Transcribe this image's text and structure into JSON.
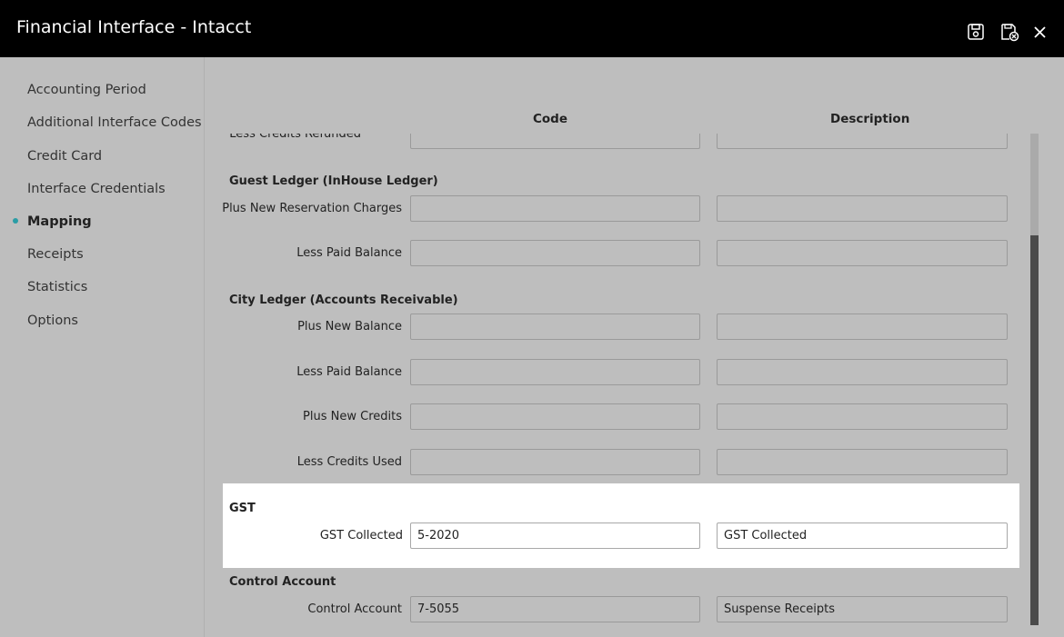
{
  "window": {
    "title": "Financial Interface - Intacct"
  },
  "toolbar": {
    "icons": [
      "save-icon",
      "save-close-icon",
      "close-icon"
    ]
  },
  "sidebar": {
    "items": [
      {
        "label": "Accounting Period"
      },
      {
        "label": "Additional Interface Codes"
      },
      {
        "label": "Credit Card"
      },
      {
        "label": "Interface Credentials"
      },
      {
        "label": "Mapping",
        "active": true
      },
      {
        "label": "Receipts"
      },
      {
        "label": "Statistics"
      },
      {
        "label": "Options"
      }
    ]
  },
  "columns": {
    "code": "Code",
    "description": "Description"
  },
  "partial_row": {
    "label": "Less Credits Refunded"
  },
  "sections": {
    "guest": {
      "title": "Guest Ledger (InHouse Ledger)",
      "rows": [
        {
          "label": "Plus New Reservation Charges",
          "code": "",
          "description": ""
        },
        {
          "label": "Less Paid Balance",
          "code": "",
          "description": ""
        }
      ]
    },
    "city": {
      "title": "City Ledger (Accounts Receivable)",
      "rows": [
        {
          "label": "Plus New Balance",
          "code": "",
          "description": ""
        },
        {
          "label": "Less Paid Balance",
          "code": "",
          "description": ""
        },
        {
          "label": "Plus New Credits",
          "code": "",
          "description": ""
        },
        {
          "label": "Less Credits Used",
          "code": "",
          "description": ""
        }
      ]
    },
    "gst": {
      "title": "GST",
      "rows": [
        {
          "label": "GST Collected",
          "code": "5-2020",
          "description": "GST Collected"
        }
      ]
    },
    "control": {
      "title": "Control Account",
      "rows": [
        {
          "label": "Control Account",
          "code": "7-5055",
          "description": "Suspense Receipts"
        }
      ]
    }
  },
  "colors": {
    "accent": "#2a9da5",
    "titlebar": "#000000",
    "background": "#bebebe",
    "highlight": "#ffffff"
  }
}
